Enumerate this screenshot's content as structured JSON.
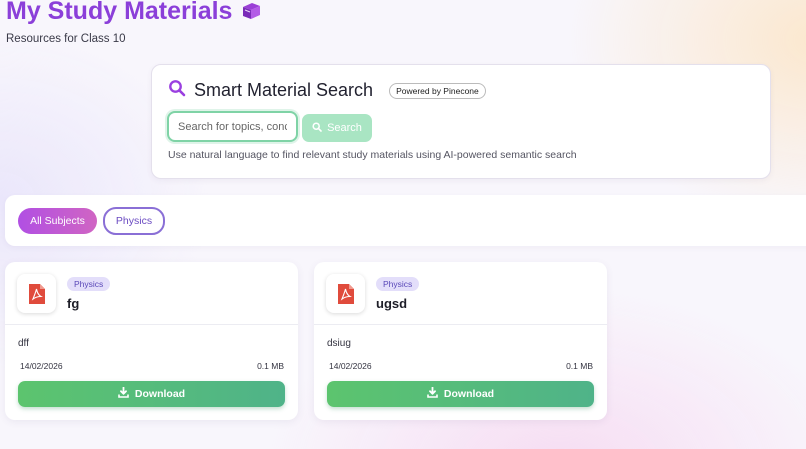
{
  "header": {
    "title": "My Study Materials",
    "subtitle": "Resources for Class 10",
    "title_icon": "books-icon",
    "title_color": "#8b3fd9"
  },
  "search": {
    "title": "Smart Material Search",
    "badge": "Powered by Pinecone",
    "placeholder": "Search for topics, concepts...",
    "button_label": "Search",
    "hint": "Use natural language to find relevant study materials using AI-powered semantic search"
  },
  "filters": {
    "chips": [
      {
        "label": "All Subjects",
        "active": true
      },
      {
        "label": "Physics",
        "active": false
      }
    ]
  },
  "materials": [
    {
      "subject": "Physics",
      "title": "fg",
      "description": "dff",
      "date": "14/02/2026",
      "size": "0.1 MB",
      "download_label": "Download",
      "icon": "pdf-icon"
    },
    {
      "subject": "Physics",
      "title": "ugsd",
      "description": "dsiug",
      "date": "14/02/2026",
      "size": "0.1 MB",
      "download_label": "Download",
      "icon": "pdf-icon"
    }
  ],
  "colors": {
    "accent": "#8b3fd9",
    "download": "#5cc46e",
    "pdf": "#e04b3c"
  }
}
